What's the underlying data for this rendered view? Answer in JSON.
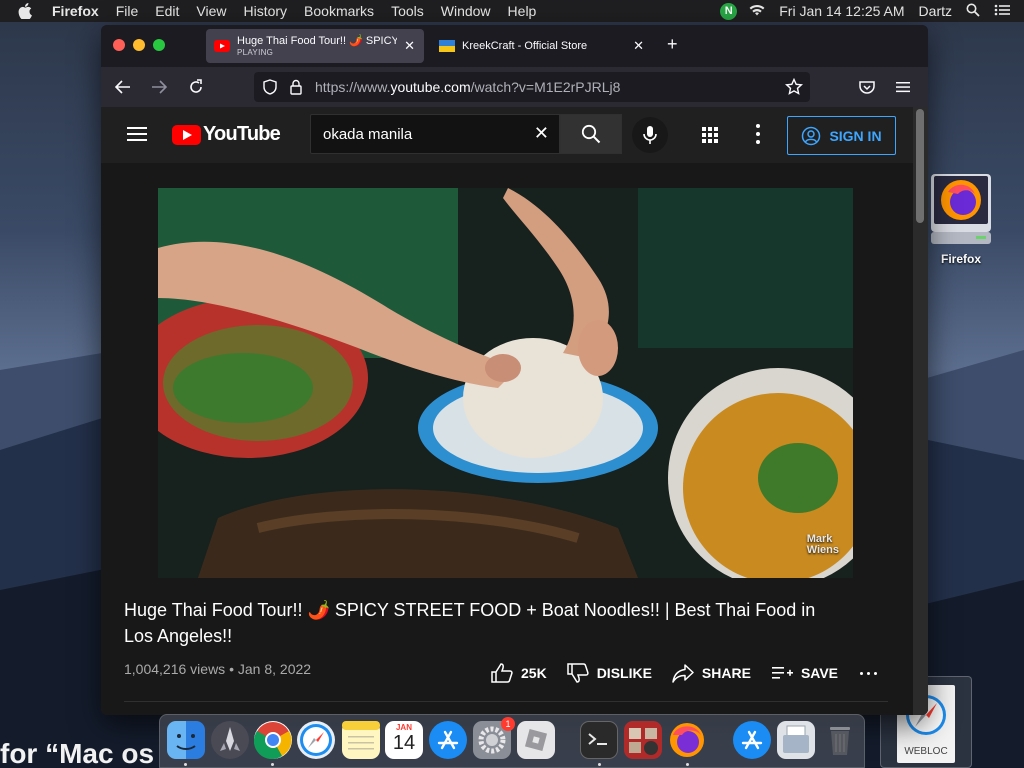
{
  "menubar": {
    "app_name": "Firefox",
    "items": [
      "File",
      "Edit",
      "View",
      "History",
      "Bookmarks",
      "Tools",
      "Window",
      "Help"
    ],
    "status_badge": "N",
    "datetime": "Fri Jan 14  12:25 AM",
    "user": "Dartz"
  },
  "browser": {
    "tabs": [
      {
        "title": "Huge Thai Food Tour!! 🌶️ SPICY",
        "subtitle": "PLAYING",
        "active": true
      },
      {
        "title": "KreekCraft - Official Store",
        "active": false
      }
    ],
    "url": {
      "prefix": "https://www.",
      "domain": "youtube.com",
      "path": "/watch?v=M1E2rPJRLj8"
    }
  },
  "youtube": {
    "logo_text": "YouTube",
    "search_query": "okada manila",
    "sign_in_label": "SIGN IN",
    "video": {
      "watermark_line1": "Mark",
      "watermark_line2": "Wiens",
      "title": "Huge Thai Food Tour!! 🌶️ SPICY STREET FOOD + Boat Noodles!! | Best Thai Food in Los Angeles!!",
      "views": "1,004,216 views",
      "separator": "•",
      "date": "Jan 8, 2022",
      "likes": "25K",
      "dislike_label": "DISLIKE",
      "share_label": "SHARE",
      "save_label": "SAVE"
    }
  },
  "desktop": {
    "firefox_label": "Firefox",
    "webloc_label": "WEBLOC",
    "bottom_text": "for “Mac os"
  },
  "dock": {
    "app_icons": [
      "finder-icon",
      "launchpad-icon",
      "chrome-icon",
      "safari-icon",
      "notes-icon",
      "calendar-icon",
      "app-store-icon",
      "system-preferences-icon",
      "roblox-icon",
      "terminal-icon",
      "photo-booth-icon",
      "firefox-icon",
      "app-store-downloads-icon",
      "documents-icon",
      "trash-icon"
    ],
    "calendar_month": "JAN",
    "calendar_day": "14",
    "prefs_badge": "1"
  }
}
